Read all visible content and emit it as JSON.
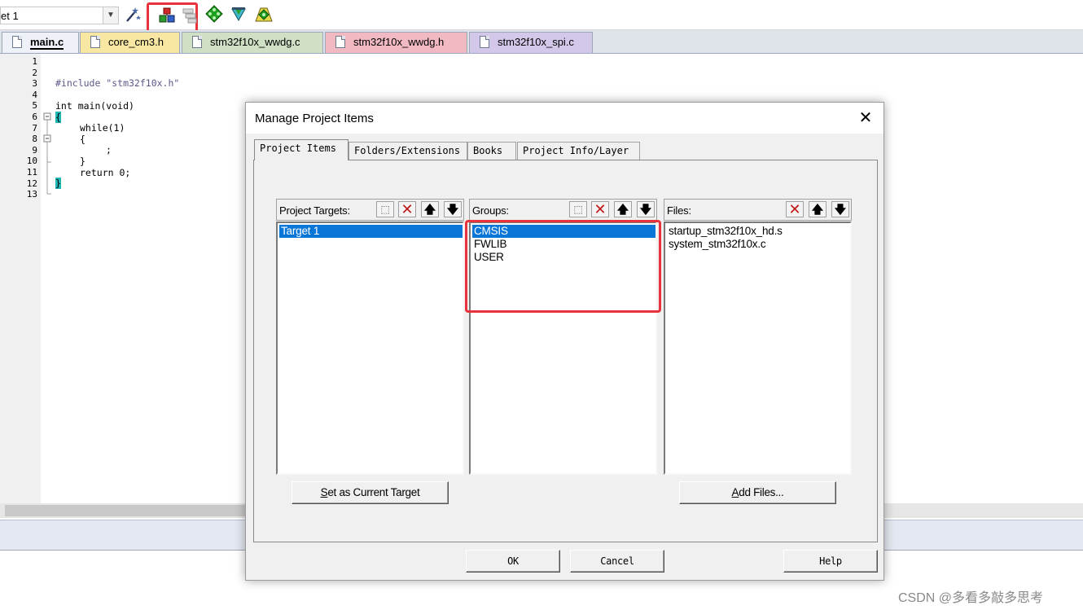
{
  "toolbar": {
    "target_value": "et 1",
    "icons": [
      "options-for-target-icon",
      "manage-project-items-icon",
      "select-packs-icon",
      "manage-run-time-environment-icon",
      "pack-installer-icon",
      "software-packs-icon"
    ]
  },
  "tabs": [
    {
      "label": "main.c",
      "color": "#e8ecf4",
      "active": true
    },
    {
      "label": "core_cm3.h",
      "color": "#f7e7a3"
    },
    {
      "label": "stm32f10x_wwdg.c",
      "color": "#cfe0c4"
    },
    {
      "label": "stm32f10x_wwdg.h",
      "color": "#f1b9c2"
    },
    {
      "label": "stm32f10x_spi.c",
      "color": "#d4c8ea"
    }
  ],
  "editor": {
    "line_numbers": [
      "1",
      "2",
      "3",
      "4",
      "5",
      "6",
      "7",
      "8",
      "9",
      "10",
      "11",
      "12",
      "13"
    ],
    "code": {
      "l3": "#include \"stm32f10x.h\"",
      "l5": "int main(void)",
      "l6": "{",
      "l7": "while(1)",
      "l8": "{",
      "l9": ";",
      "l10": "}",
      "l11": "return 0;",
      "l12": "}"
    }
  },
  "dialog": {
    "title": "Manage Project Items",
    "close": "✕",
    "tabs": [
      "Project Items",
      "Folders/Extensions",
      "Books",
      "Project Info/Layer"
    ],
    "targets": {
      "header": "Project Targets:",
      "items": [
        "Target 1"
      ]
    },
    "groups": {
      "header": "Groups:",
      "items": [
        "CMSIS",
        "FWLIB",
        "USER"
      ]
    },
    "files": {
      "header": "Files:",
      "items": [
        "startup_stm32f10x_hd.s",
        "system_stm32f10x.c"
      ]
    },
    "buttons": {
      "set_current_u": "S",
      "set_current_rest": "et as Current Target",
      "add_files_u": "A",
      "add_files_rest": "dd Files...",
      "ok": "OK",
      "cancel": "Cancel",
      "help": "Help"
    },
    "glyphs": {
      "new": "⬚",
      "delete": "✕",
      "up": "🡅",
      "down": "🡇"
    }
  },
  "watermark": "CSDN @多看多敲多思考",
  "colors": {
    "highlight": "#e8323c",
    "selection": "#0a76d8"
  }
}
